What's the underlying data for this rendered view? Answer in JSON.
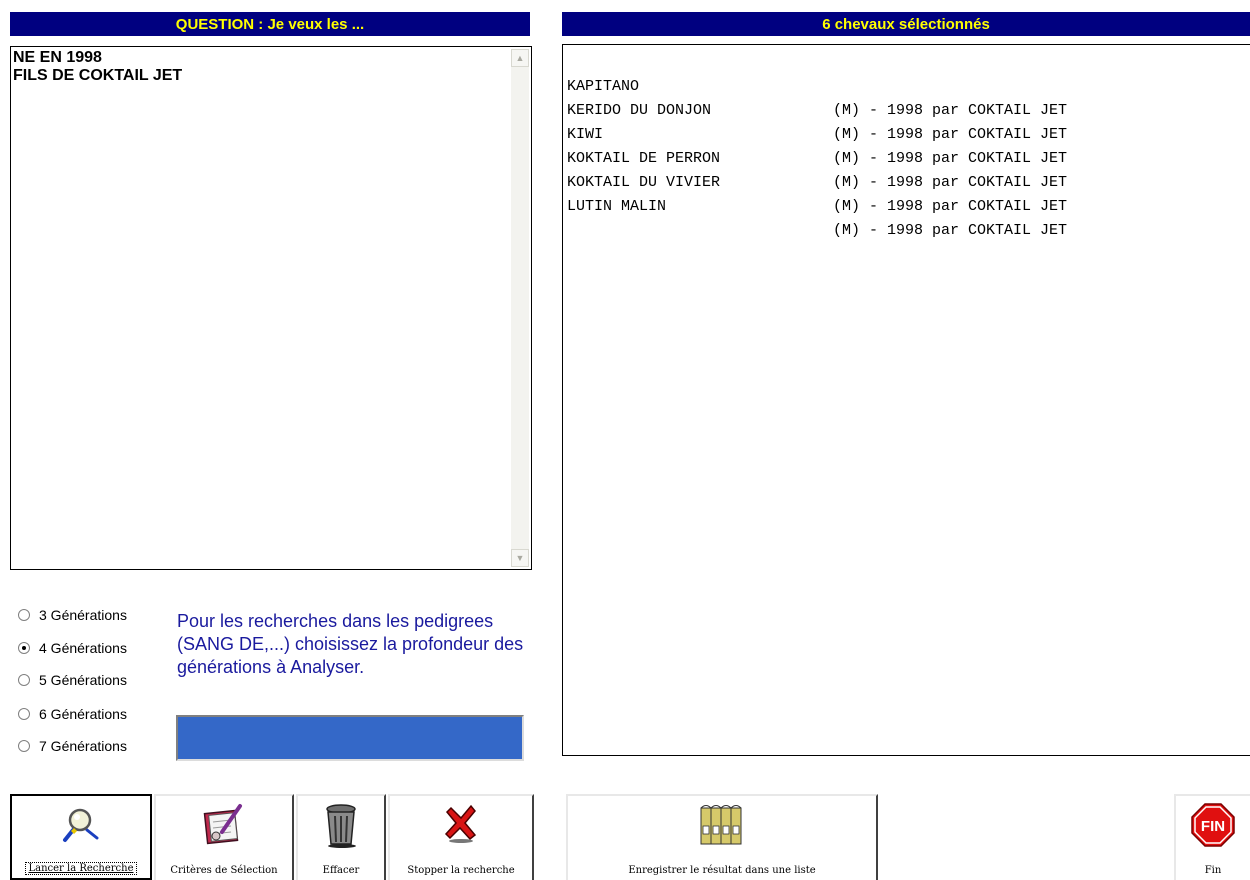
{
  "question": {
    "title": "QUESTION : Je veux les ...",
    "lines": "NE EN 1998\nFILS DE COKTAIL JET"
  },
  "results": {
    "title": "6 chevaux sélectionnés",
    "rows": [
      {
        "name": "KAPITANO",
        "info": "(M) - 1998 par COKTAIL JET"
      },
      {
        "name": "KERIDO DU DONJON",
        "info": "(M) - 1998 par COKTAIL JET"
      },
      {
        "name": "KIWI",
        "info": "(M) - 1998 par COKTAIL JET"
      },
      {
        "name": "KOKTAIL DE PERRON",
        "info": "(M) - 1998 par COKTAIL JET"
      },
      {
        "name": "KOKTAIL DU VIVIER",
        "info": "(M) - 1998 par COKTAIL JET"
      },
      {
        "name": "LUTIN MALIN",
        "info": "(M) - 1998 par COKTAIL JET"
      }
    ]
  },
  "generations": {
    "options": [
      "3 Générations",
      "4 Générations",
      "5 Générations",
      "6 Générations",
      "7 Générations"
    ],
    "selected": "4 Générations",
    "help_text": "Pour les recherches dans les pedigrees (SANG DE,...) choisissez la profondeur des générations à Analyser.",
    "progress_fraction": 1.0
  },
  "toolbar": {
    "search_label": "Lancer la Recherche",
    "criteria_label": "Critères de Sélection",
    "clear_label": "Effacer",
    "stop_label": "Stopper la recherche",
    "save_list_label": "Enregistrer le résultat dans une liste",
    "exit_label": "Fin",
    "exit_sign_text": "FIN"
  },
  "colors": {
    "title_bar_bg": "#000080",
    "title_bar_text": "#ffff00",
    "help_text": "#1a1a9e",
    "progress": "#3468c8"
  }
}
